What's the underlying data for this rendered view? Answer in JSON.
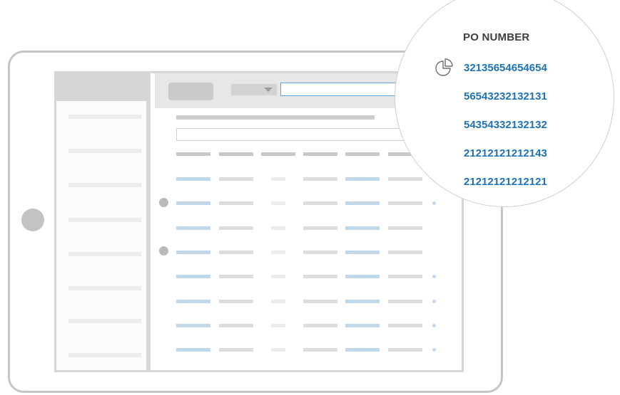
{
  "popup": {
    "title": "PO NUMBER",
    "icon": "pie-chart-icon",
    "numbers": [
      "32135654654654",
      "56543232132131",
      "54354332132132",
      "21212121212143",
      "21212121212121"
    ]
  },
  "colors": {
    "accent": "#1d73b4",
    "frame": "#c6c6c6",
    "placeholder_blue": "#c1d7ea",
    "placeholder_gray": "#dddddd"
  }
}
